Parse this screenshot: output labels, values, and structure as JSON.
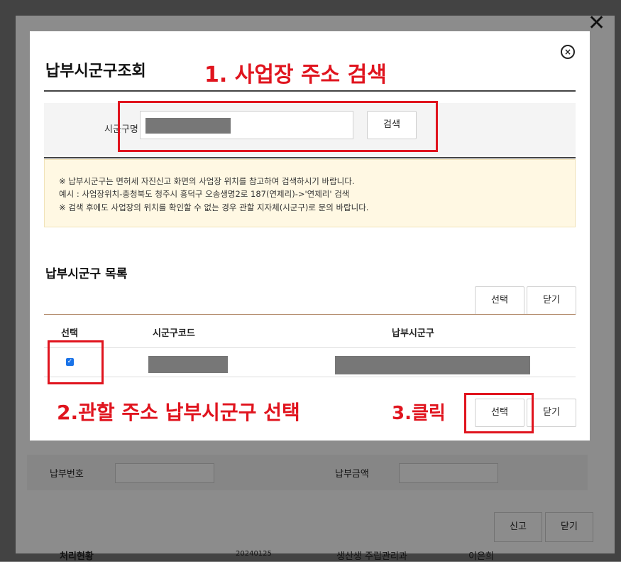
{
  "background": {
    "row_labels": [
      "납부번호",
      "납부금액"
    ],
    "buttons": {
      "report": "신고",
      "close": "닫기"
    },
    "footer_cells": [
      "처리현황",
      "20240125",
      "생산생 주립관리과",
      "이은희"
    ]
  },
  "outer_close_icon": "✕",
  "modal": {
    "title": "납부시군구조회",
    "close_icon": "⊗",
    "search": {
      "label": "시군구명",
      "input_value": "",
      "button": "검색"
    },
    "notice": [
      "※ 납부시군구는 면허세 자진신고 화면의 사업장 위치를 참고하여 검색하시기 바랍니다.",
      "예시 : 사업장위치-충청북도 청주시 흥덕구 오송생명2로 187(연제리)->'연제리' 검색",
      "※ 검색 후에도 사업장의 위치를 확인할 수 없는 경우 관할 지자체(시군구)로 문의 바랍니다."
    ],
    "list": {
      "title": "납부시군구 목록",
      "top_buttons": {
        "select": "선택",
        "close": "닫기"
      },
      "columns": [
        "선택",
        "시군구코드",
        "납부시군구"
      ],
      "rows": [
        {
          "checked": true,
          "code": "",
          "name": ""
        }
      ],
      "bottom_buttons": {
        "select": "선택",
        "close": "닫기"
      }
    }
  },
  "annotations": {
    "step1": "1. 사업장 주소 검색",
    "step2": "2.관할 주소 납부시군구 선택",
    "step3": "3.클릭"
  },
  "colors": {
    "annotation_red": "#e0141e",
    "checkbox_blue": "#1a73e8",
    "notice_bg": "#fff8e3"
  }
}
